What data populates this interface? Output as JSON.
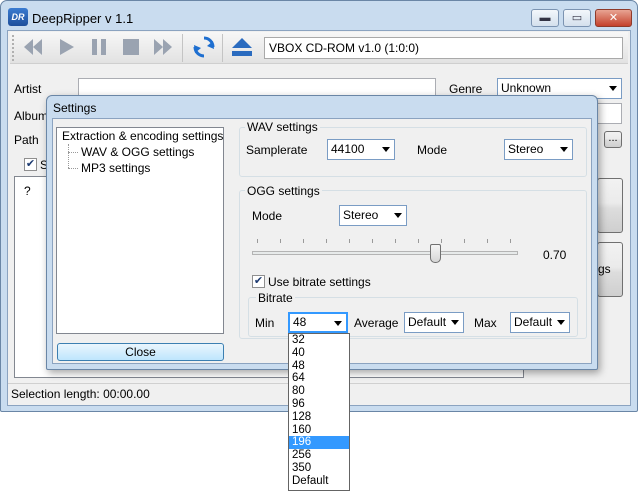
{
  "window": {
    "title": "DeepRipper v 1.1",
    "logo_text": "DR",
    "min_glyph": "▬",
    "max_glyph": "▭",
    "close_glyph": "✕"
  },
  "toolbar": {
    "buttons": [
      "rewind-icon",
      "play-icon",
      "pause-icon",
      "stop-icon",
      "fast-forward-icon",
      "refresh-icon",
      "eject-icon"
    ],
    "device": "VBOX CD-ROM v1.0 (1:0:0)"
  },
  "form": {
    "artist_label": "Artist",
    "album_label": "Album",
    "path_label": "Path",
    "genre_label": "Genre",
    "genre_value": "Unknown",
    "browse_label": "...",
    "select_all_partial": "S",
    "column_question": "?",
    "right_button_partial": "gs"
  },
  "status": {
    "selection_length": "Selection length:  00:00.00"
  },
  "settings": {
    "title": "Settings",
    "tree": {
      "root": "Extraction & encoding settings",
      "child1": "WAV & OGG settings",
      "child2": "MP3 settings"
    },
    "close_label": "Close",
    "wav": {
      "group": "WAV settings",
      "samplerate_label": "Samplerate",
      "samplerate_value": "44100",
      "mode_label": "Mode",
      "mode_value": "Stereo"
    },
    "ogg": {
      "group": "OGG settings",
      "mode_label": "Mode",
      "mode_value": "Stereo",
      "quality_value": "0.70",
      "use_bitrate_label": "Use bitrate settings",
      "use_bitrate_checked": true,
      "bitrate_group": "Bitrate",
      "min_label": "Min",
      "min_value": "48",
      "average_label": "Average",
      "average_value": "Default",
      "max_label": "Max",
      "max_value": "Default"
    },
    "bitrate_options": [
      "32",
      "40",
      "48",
      "64",
      "80",
      "96",
      "128",
      "160",
      "196",
      "256",
      "350",
      "Default"
    ],
    "highlighted_option": "196"
  }
}
